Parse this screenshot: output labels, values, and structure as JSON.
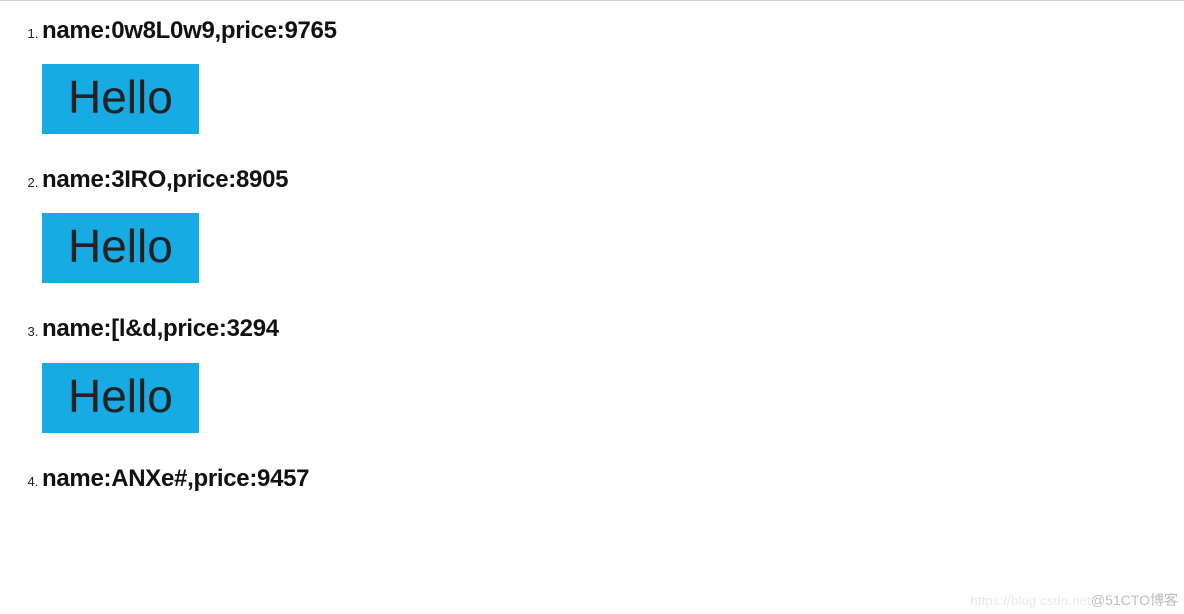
{
  "items": [
    {
      "name": "0w8L0w9",
      "price": "9765",
      "box": "Hello"
    },
    {
      "name": "3IRO",
      "price": "8905",
      "box": "Hello"
    },
    {
      "name": "[l&d",
      "price": "3294",
      "box": "Hello"
    },
    {
      "name": "ANXe#",
      "price": "9457"
    }
  ],
  "labels": {
    "name_prefix": "name:",
    "price_prefix": "price:"
  },
  "watermark": {
    "faint": "https://blog.csdn.net",
    "text": "@51CTO博客"
  }
}
